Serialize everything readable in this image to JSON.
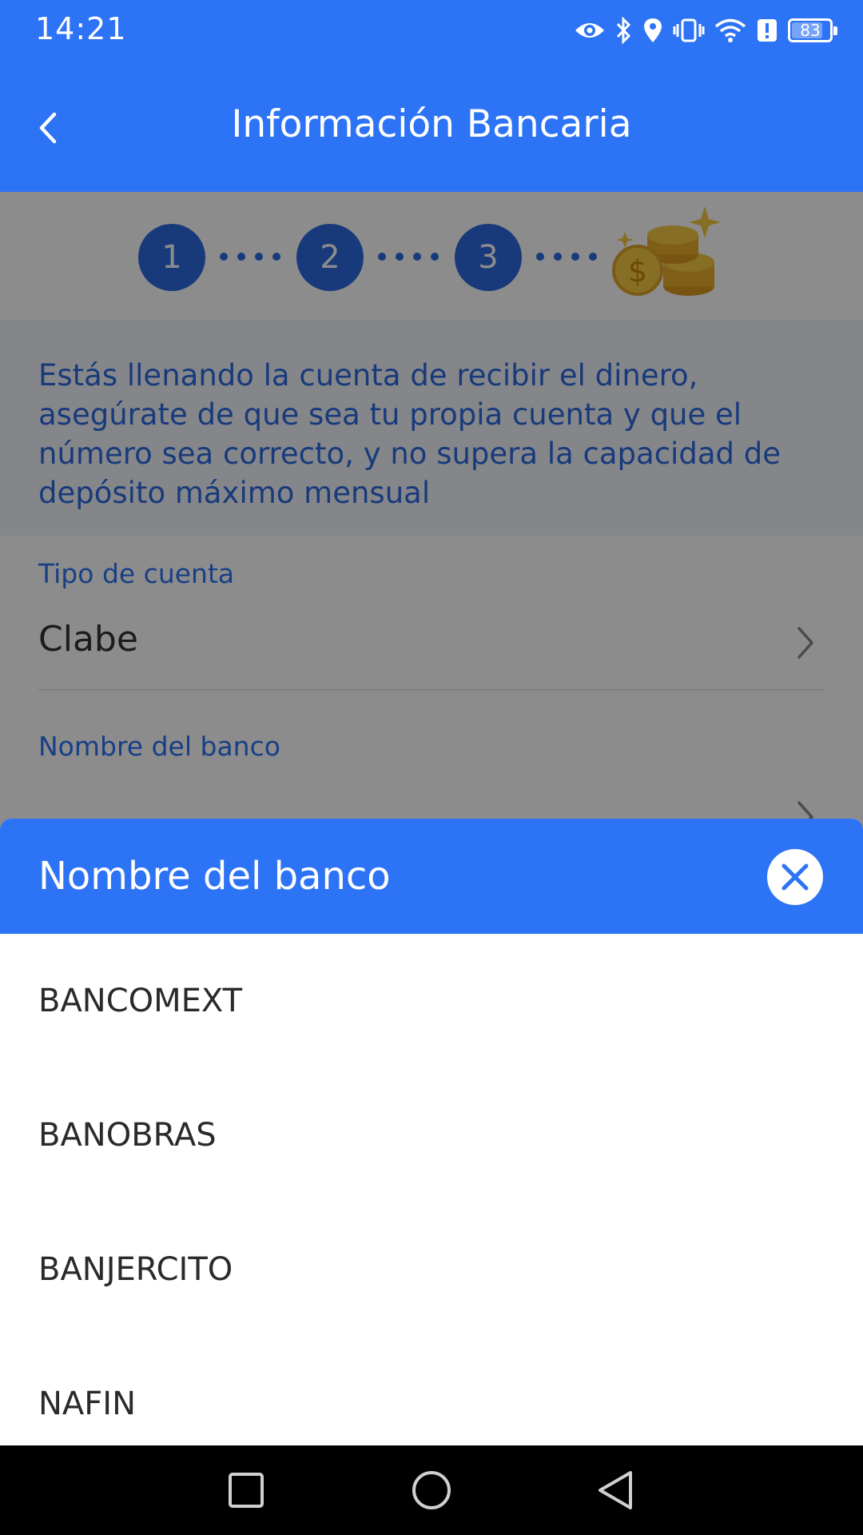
{
  "status_bar": {
    "time": "14:21",
    "battery": "83",
    "battery_level": 0.83,
    "icons": [
      "eye-icon",
      "bluetooth-icon",
      "location-icon",
      "vibrate-icon",
      "wifi-icon",
      "alert-icon",
      "battery-icon"
    ]
  },
  "header": {
    "title": "Información Bancaria",
    "back_icon": "chevron-left-icon",
    "color": "#2d73f5"
  },
  "stepper": {
    "steps": [
      "1",
      "2",
      "3"
    ],
    "reward_icon": "coins-icon"
  },
  "notice": {
    "text": "Estás llenando la cuenta de recibir el dinero, asegúrate de que sea tu propia cuenta y que el número sea correcto, y no supera la capacidad de depósito máximo mensual"
  },
  "form": {
    "account_type_label": "Tipo de cuenta",
    "account_type_value": "Clabe",
    "bank_name_label": "Nombre del banco"
  },
  "sheet": {
    "title": "Nombre del banco",
    "close_icon": "close-icon",
    "banks": [
      "BANCOMEXT",
      "BANOBRAS",
      "BANJERCITO",
      "NAFIN"
    ]
  },
  "nav_bar": {
    "icons": [
      "recents-square-icon",
      "home-circle-icon",
      "back-triangle-icon"
    ]
  }
}
